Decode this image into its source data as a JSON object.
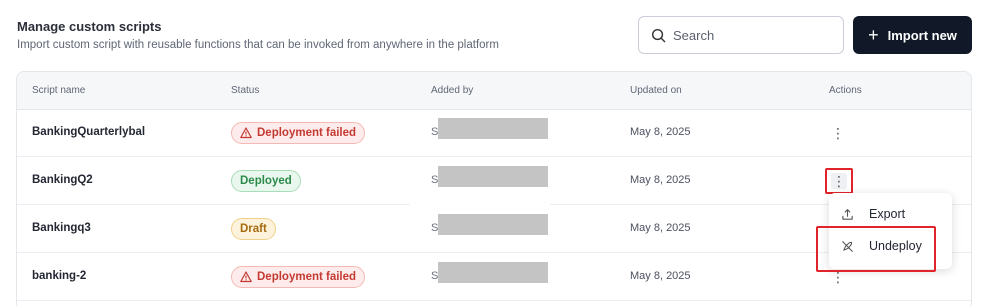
{
  "header": {
    "title": "Manage custom scripts",
    "subtitle": "Import custom script with reusable functions that can be invoked from anywhere in the platform"
  },
  "search": {
    "placeholder": "Search",
    "value": ""
  },
  "import_button": {
    "label": "Import new"
  },
  "table": {
    "columns": [
      "Script name",
      "Status",
      "Added by",
      "Updated on",
      "Actions"
    ],
    "rows": [
      {
        "name": "BankingQuarterlybal",
        "status": "Deployment failed",
        "status_type": "failed",
        "added_by": "S",
        "updated_on": "May 8, 2025"
      },
      {
        "name": "BankingQ2",
        "status": "Deployed",
        "status_type": "deployed",
        "added_by": "S",
        "updated_on": "May 8, 2025"
      },
      {
        "name": "Bankingq3",
        "status": "Draft",
        "status_type": "draft",
        "added_by": "S",
        "updated_on": "May 8, 2025"
      },
      {
        "name": "banking-2",
        "status": "Deployment failed",
        "status_type": "failed",
        "added_by": "S",
        "updated_on": "May 8, 2025"
      }
    ],
    "actions_glyph": "⋮"
  },
  "context_menu": {
    "items": [
      {
        "label": "Export",
        "icon": "export-icon"
      },
      {
        "label": "Undeploy",
        "icon": "undeploy-icon"
      }
    ]
  },
  "colors": {
    "primary_button": "#111827",
    "failed": "#c43a33",
    "deployed": "#2c8a4a",
    "draft": "#a46b0f",
    "highlight": "#e0242a"
  }
}
